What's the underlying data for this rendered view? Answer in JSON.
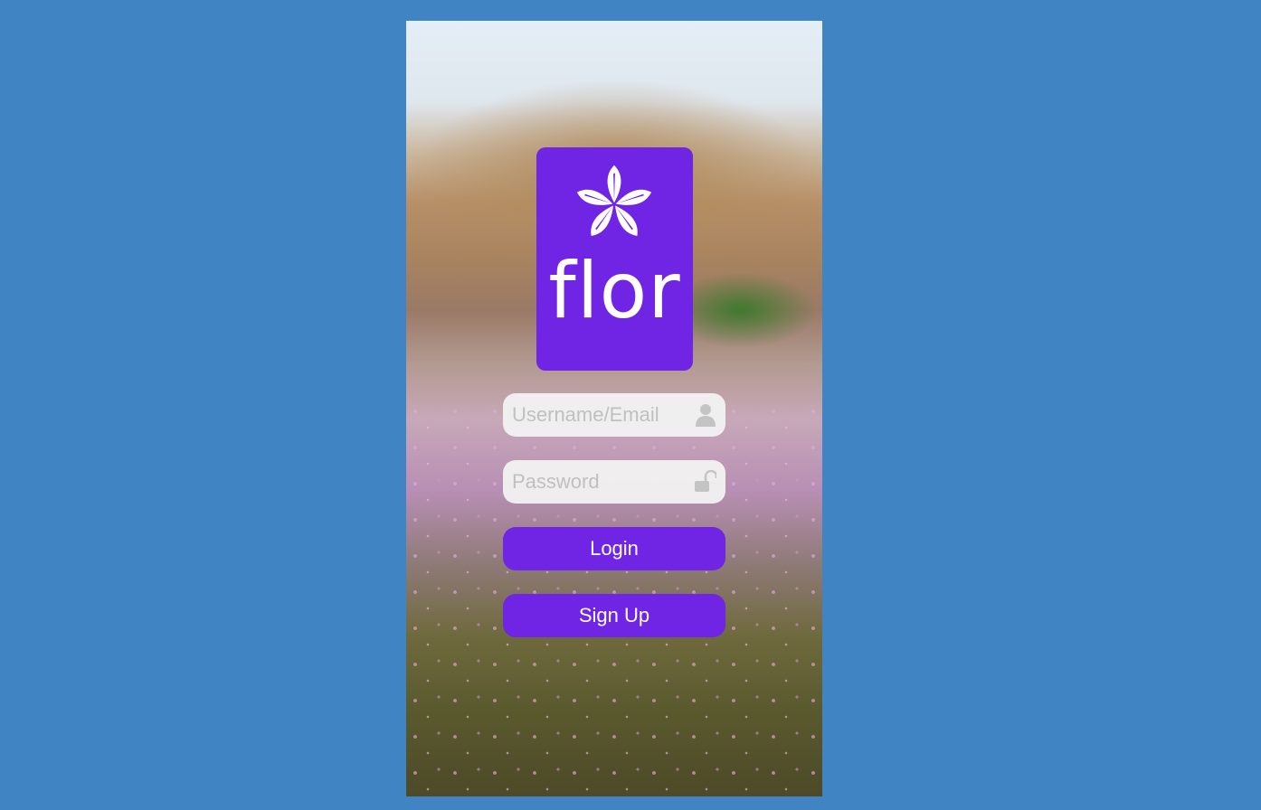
{
  "app": {
    "name": "flor",
    "logo_icon": "flower-icon"
  },
  "login_form": {
    "username_placeholder": "Username/Email",
    "username_value": "",
    "username_icon": "user-icon",
    "password_placeholder": "Password",
    "password_value": "",
    "password_icon": "unlock-icon",
    "login_label": "Login",
    "signup_label": "Sign Up"
  },
  "colors": {
    "accent": "#7024e4",
    "page_background": "#4084c4",
    "field_background": "#f2f2f2",
    "placeholder": "#c0c0c0"
  }
}
